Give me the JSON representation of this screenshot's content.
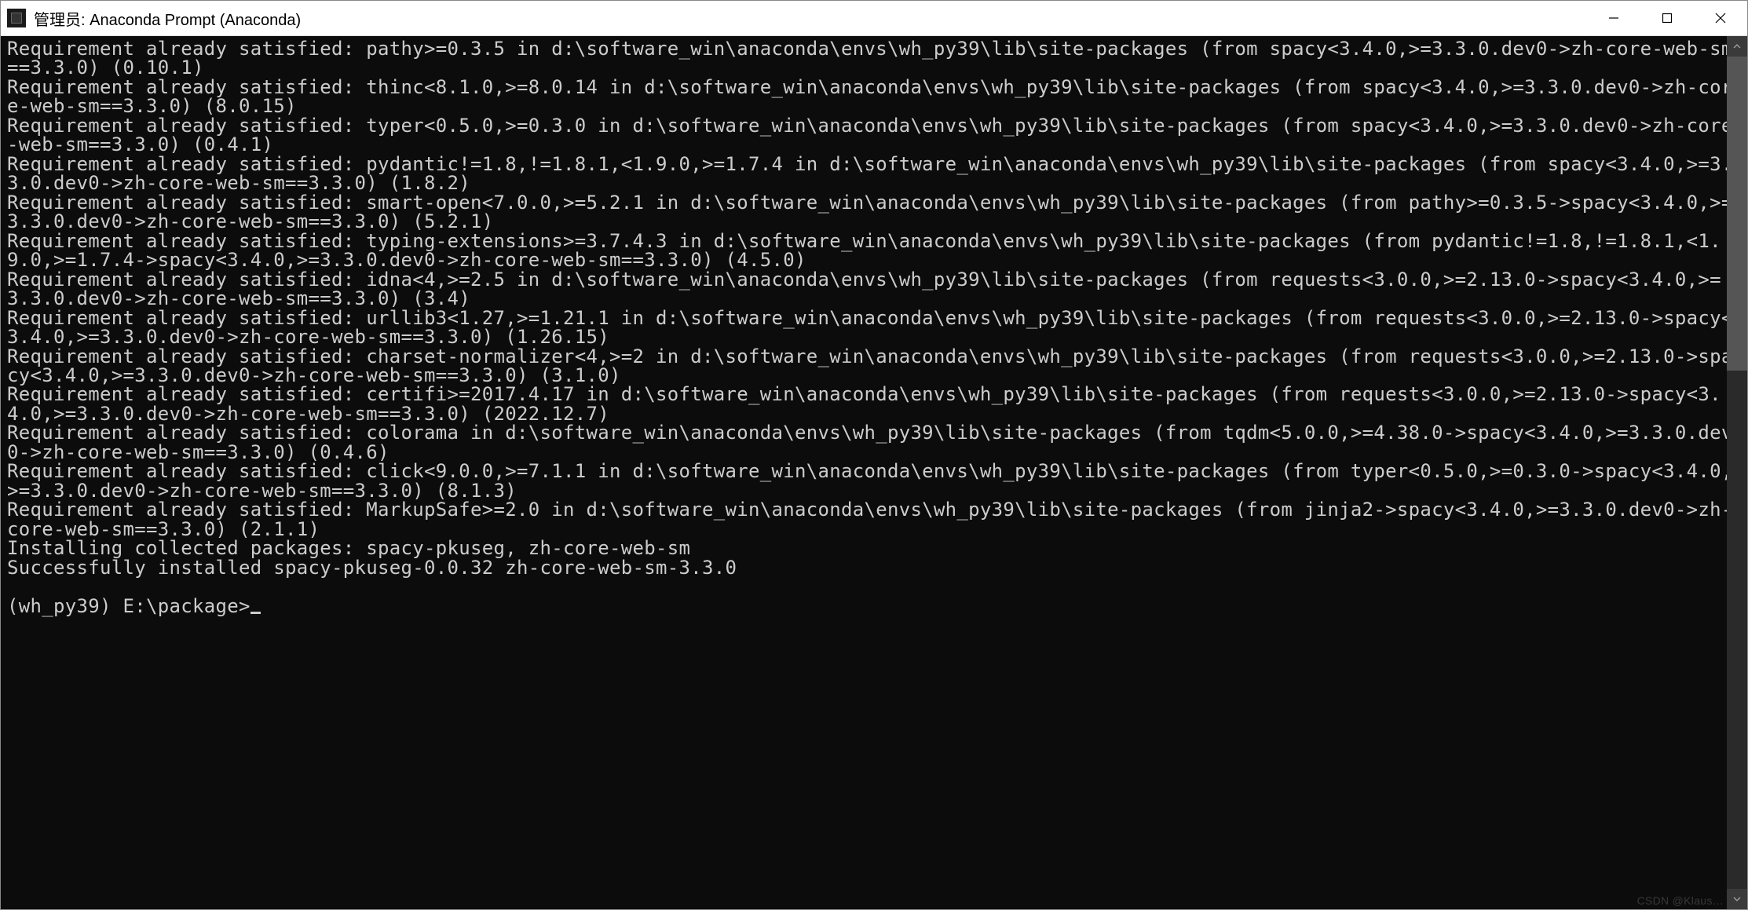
{
  "window": {
    "title": "管理员: Anaconda Prompt (Anaconda)"
  },
  "terminal": {
    "lines": [
      "Requirement already satisfied: pathy>=0.3.5 in d:\\software_win\\anaconda\\envs\\wh_py39\\lib\\site-packages (from spacy<3.4.0,>=3.3.0.dev0->zh-core-web-sm==3.3.0) (0.10.1)",
      "Requirement already satisfied: thinc<8.1.0,>=8.0.14 in d:\\software_win\\anaconda\\envs\\wh_py39\\lib\\site-packages (from spacy<3.4.0,>=3.3.0.dev0->zh-core-web-sm==3.3.0) (8.0.15)",
      "Requirement already satisfied: typer<0.5.0,>=0.3.0 in d:\\software_win\\anaconda\\envs\\wh_py39\\lib\\site-packages (from spacy<3.4.0,>=3.3.0.dev0->zh-core-web-sm==3.3.0) (0.4.1)",
      "Requirement already satisfied: pydantic!=1.8,!=1.8.1,<1.9.0,>=1.7.4 in d:\\software_win\\anaconda\\envs\\wh_py39\\lib\\site-packages (from spacy<3.4.0,>=3.3.0.dev0->zh-core-web-sm==3.3.0) (1.8.2)",
      "Requirement already satisfied: smart-open<7.0.0,>=5.2.1 in d:\\software_win\\anaconda\\envs\\wh_py39\\lib\\site-packages (from pathy>=0.3.5->spacy<3.4.0,>=3.3.0.dev0->zh-core-web-sm==3.3.0) (5.2.1)",
      "Requirement already satisfied: typing-extensions>=3.7.4.3 in d:\\software_win\\anaconda\\envs\\wh_py39\\lib\\site-packages (from pydantic!=1.8,!=1.8.1,<1.9.0,>=1.7.4->spacy<3.4.0,>=3.3.0.dev0->zh-core-web-sm==3.3.0) (4.5.0)",
      "Requirement already satisfied: idna<4,>=2.5 in d:\\software_win\\anaconda\\envs\\wh_py39\\lib\\site-packages (from requests<3.0.0,>=2.13.0->spacy<3.4.0,>=3.3.0.dev0->zh-core-web-sm==3.3.0) (3.4)",
      "Requirement already satisfied: urllib3<1.27,>=1.21.1 in d:\\software_win\\anaconda\\envs\\wh_py39\\lib\\site-packages (from requests<3.0.0,>=2.13.0->spacy<3.4.0,>=3.3.0.dev0->zh-core-web-sm==3.3.0) (1.26.15)",
      "Requirement already satisfied: charset-normalizer<4,>=2 in d:\\software_win\\anaconda\\envs\\wh_py39\\lib\\site-packages (from requests<3.0.0,>=2.13.0->spacy<3.4.0,>=3.3.0.dev0->zh-core-web-sm==3.3.0) (3.1.0)",
      "Requirement already satisfied: certifi>=2017.4.17 in d:\\software_win\\anaconda\\envs\\wh_py39\\lib\\site-packages (from requests<3.0.0,>=2.13.0->spacy<3.4.0,>=3.3.0.dev0->zh-core-web-sm==3.3.0) (2022.12.7)",
      "Requirement already satisfied: colorama in d:\\software_win\\anaconda\\envs\\wh_py39\\lib\\site-packages (from tqdm<5.0.0,>=4.38.0->spacy<3.4.0,>=3.3.0.dev0->zh-core-web-sm==3.3.0) (0.4.6)",
      "Requirement already satisfied: click<9.0.0,>=7.1.1 in d:\\software_win\\anaconda\\envs\\wh_py39\\lib\\site-packages (from typer<0.5.0,>=0.3.0->spacy<3.4.0,>=3.3.0.dev0->zh-core-web-sm==3.3.0) (8.1.3)",
      "Requirement already satisfied: MarkupSafe>=2.0 in d:\\software_win\\anaconda\\envs\\wh_py39\\lib\\site-packages (from jinja2->spacy<3.4.0,>=3.3.0.dev0->zh-core-web-sm==3.3.0) (2.1.1)",
      "Installing collected packages: spacy-pkuseg, zh-core-web-sm",
      "Successfully installed spacy-pkuseg-0.0.32 zh-core-web-sm-3.3.0",
      ""
    ],
    "prompt": "(wh_py39) E:\\package>"
  },
  "watermark": "CSDN @Klaus…"
}
